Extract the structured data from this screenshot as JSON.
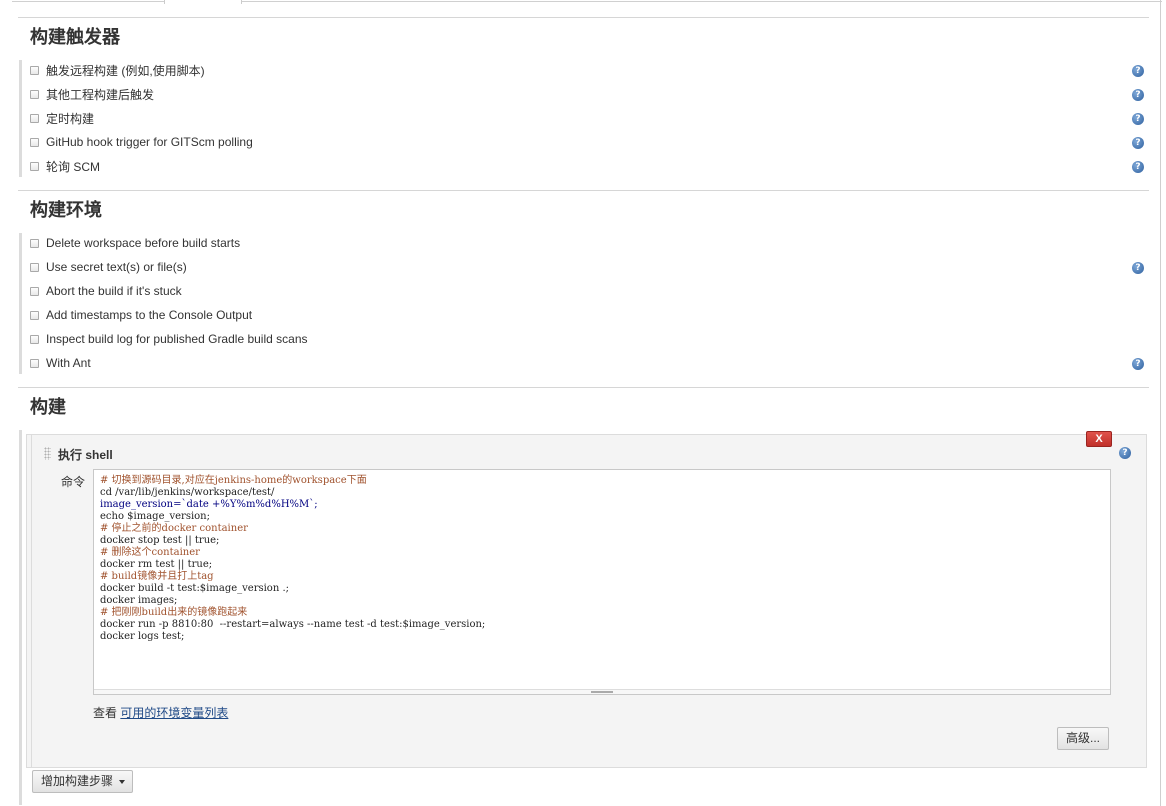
{
  "triggers": {
    "title": "构建触发器",
    "options": [
      {
        "label": "触发远程构建 (例如,使用脚本)",
        "help": true
      },
      {
        "label": "其他工程构建后触发",
        "help": true
      },
      {
        "label": "定时构建",
        "help": true
      },
      {
        "label": "GitHub hook trigger for GITScm polling",
        "help": true
      },
      {
        "label": "轮询 SCM",
        "help": true
      }
    ]
  },
  "environment": {
    "title": "构建环境",
    "options": [
      {
        "label": "Delete workspace before build starts",
        "help": false
      },
      {
        "label": "Use secret text(s) or file(s)",
        "help": true
      },
      {
        "label": "Abort the build if it's stuck",
        "help": false
      },
      {
        "label": "Add timestamps to the Console Output",
        "help": false
      },
      {
        "label": "Inspect build log for published Gradle build scans",
        "help": false
      },
      {
        "label": "With Ant",
        "help": true
      }
    ]
  },
  "build": {
    "title": "构建",
    "step_title": "执行 shell",
    "delete_label": "X",
    "command_label": "命令",
    "command_lines": [
      "# 切换到源码目录,对应在jenkins-home的workspace下面",
      "cd /var/lib/jenkins/workspace/test/",
      "image_version=`date +%Y%m%d%H%M`;",
      "echo $image_version;",
      "# 停止之前的docker container",
      "docker stop test || true;",
      "# 删除这个container",
      "docker rm test || true;",
      "# build镜像并且打上tag",
      "docker build -t test:$image_version .;",
      "docker images;",
      "# 把刚刚build出来的镜像跑起来",
      "docker run -p 8810:80  --restart=always --name test -d test:$image_version;",
      "docker logs test;"
    ],
    "env_hint_prefix": "查看",
    "env_hint_link": "可用的环境变量列表",
    "advanced_label": "高级...",
    "add_step_label": "增加构建步骤"
  },
  "icons": {
    "help": "help-icon",
    "drag": "drag-handle-icon",
    "dropdown": "caret-down-icon"
  },
  "colors": {
    "help_icon": "#2d5f9e",
    "delete_button": "#d03f38",
    "link": "#204a87"
  }
}
